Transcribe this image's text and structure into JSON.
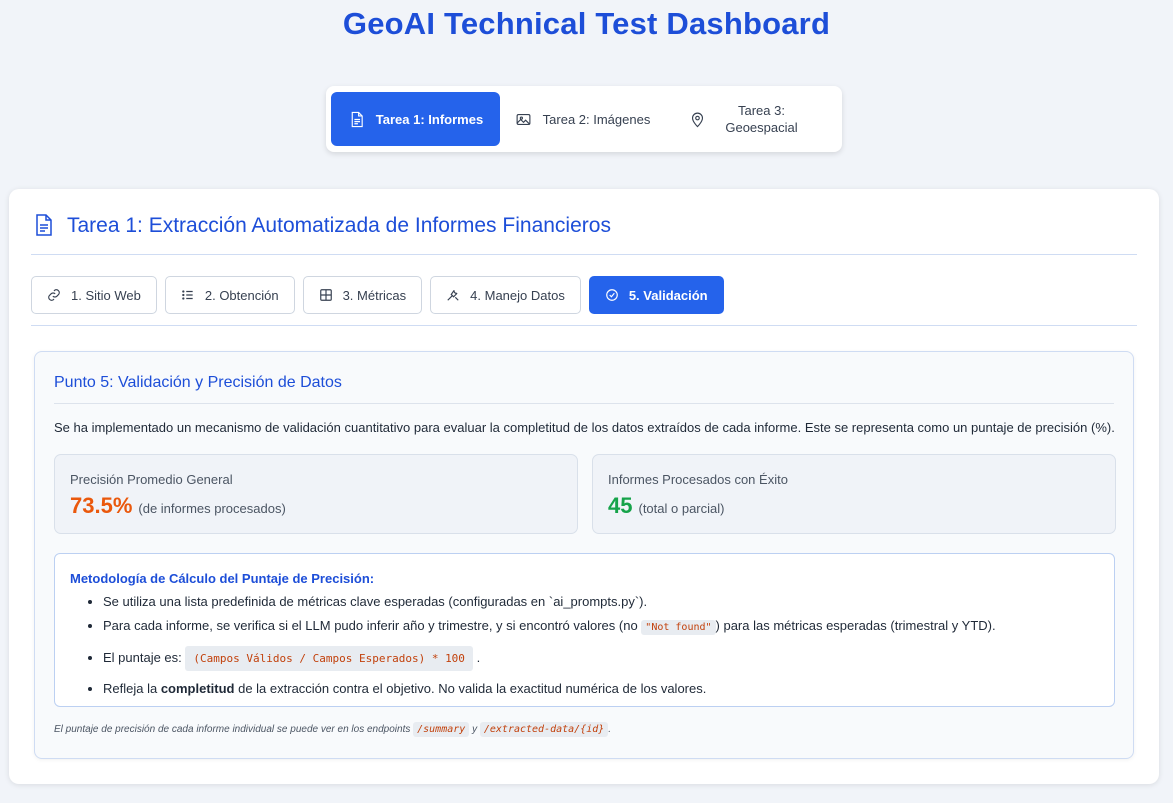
{
  "app_title": "GeoAI Technical Test Dashboard",
  "main_tabs": [
    {
      "label": "Tarea 1: Informes",
      "icon": "report-icon",
      "active": true
    },
    {
      "label": "Tarea 2: Imágenes",
      "icon": "image-icon",
      "active": false
    },
    {
      "label": "Tarea 3: Geoespacial",
      "icon": "map-pin-icon",
      "active": false
    }
  ],
  "card": {
    "title": "Tarea 1: Extracción Automatizada de Informes Financieros",
    "icon": "report-icon"
  },
  "sub_tabs": [
    {
      "label": "1. Sitio Web",
      "icon": "link-icon",
      "active": false
    },
    {
      "label": "2. Obtención",
      "icon": "list-icon",
      "active": false
    },
    {
      "label": "3. Métricas",
      "icon": "table-icon",
      "active": false
    },
    {
      "label": "4. Manejo Datos",
      "icon": "tools-icon",
      "active": false
    },
    {
      "label": "5. Validación",
      "icon": "check-circle-icon",
      "active": true
    }
  ],
  "panel": {
    "title": "Punto 5: Validación y Precisión de Datos",
    "description": "Se ha implementado un mecanismo de validación cuantitativo para evaluar la completitud de los datos extraídos de cada informe. Este se representa como un puntaje de precisión (%).",
    "stats": [
      {
        "label": "Precisión Promedio General",
        "value": "73.5%",
        "note": "(de informes procesados)",
        "color": "#ea580c"
      },
      {
        "label": "Informes Procesados con Éxito",
        "value": "45",
        "note": "(total o parcial)",
        "color": "#16a34a"
      }
    ],
    "methodology": {
      "title": "Metodología de Cálculo del Puntaje de Precisión:",
      "item1": "Se utiliza una lista predefinida de métricas clave esperadas (configuradas en `ai_prompts.py`).",
      "item2_pre": "Para cada informe, se verifica si el LLM pudo inferir año y trimestre, y si encontró valores (no ",
      "item2_code": "\"Not found\"",
      "item2_post": ") para las métricas esperadas (trimestral y YTD).",
      "item3_pre": "El puntaje es:",
      "item3_code": "(Campos Válidos / Campos Esperados) * 100",
      "item3_post": ".",
      "item4_pre": "Refleja la ",
      "item4_bold": "completitud",
      "item4_post": " de la extracción contra el objetivo. No valida la exactitud numérica de los valores."
    },
    "footnote": {
      "pre": "El puntaje de precisión de cada informe individual se puede ver en los endpoints ",
      "code1": "/summary",
      "mid": " y ",
      "code2": "/extracted-data/{id}",
      "post": "."
    }
  },
  "colors": {
    "accent": "#2563eb",
    "title": "#1d4ed8",
    "orange": "#ea580c",
    "green": "#16a34a"
  }
}
